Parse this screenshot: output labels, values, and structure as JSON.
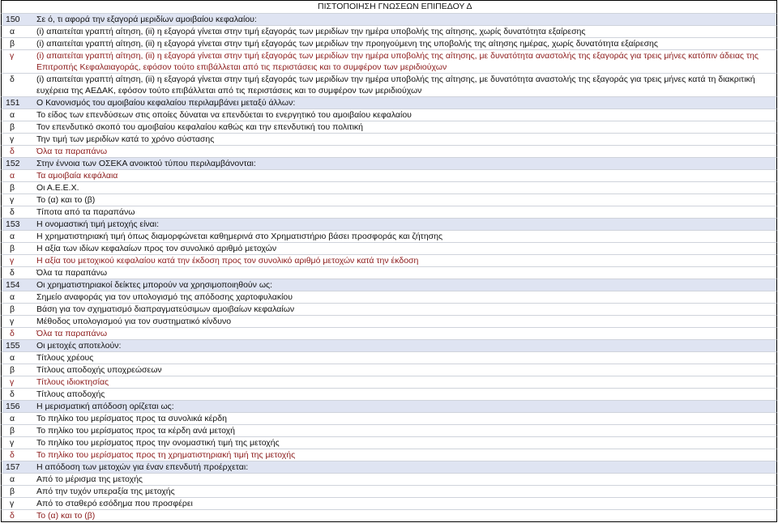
{
  "header": {
    "title": "ΠΙΣΤΟΠΟΙΗΣΗ ΓΝΩΣΕΩΝ ΕΠΙΠΕΔΟΥ Δ"
  },
  "questions": [
    {
      "number": "150",
      "text": "Σε ό, τι αφορά την εξαγορά μεριδίων αμοιβαίου κεφαλαίου:",
      "options": [
        {
          "letter": "α",
          "text": "(i) απαιτείται γραπτή αίτηση, (ii) η εξαγορά γίνεται στην τιμή εξαγοράς των μεριδίων την ημέρα υποβολής της αίτησης, χωρίς δυνατότητα εξαίρεσης",
          "correct": false
        },
        {
          "letter": "β",
          "text": "(i) απαιτείται γραπτή αίτηση, (ii) η εξαγορά γίνεται στην τιμή εξαγοράς των μεριδίων την προηγούμενη της υποβολής της αίτησης ημέρας, χωρίς δυνατότητα εξαίρεσης",
          "correct": false
        },
        {
          "letter": "γ",
          "text": "(i) απαιτείται γραπτή αίτηση, (ii) η εξαγορά γίνεται στην τιμή εξαγοράς των μεριδίων την ημέρα υποβολής της αίτησης, με δυνατότητα αναστολής της εξαγοράς για τρεις μήνες κατόπιν άδειας της Επιτροπής Κεφαλαιαγοράς, εφόσον τούτο επιβάλλεται από τις περιστάσεις και το συμφέρον των μεριδιούχων",
          "correct": true
        },
        {
          "letter": "δ",
          "text": "(i) απαιτείται γραπτή αίτηση, (ii) η εξαγορά γίνεται στην τιμή εξαγοράς των μεριδίων την ημέρα υποβολής της αίτησης, με δυνατότητα αναστολής της εξαγοράς για τρεις μήνες κατά τη διακριτική ευχέρεια της ΑΕΔΑΚ, εφόσον τούτο επιβάλλεται από τις περιστάσεις και το συμφέρον των μεριδιούχων",
          "correct": false
        }
      ]
    },
    {
      "number": "151",
      "text": "Ο Κανονισμός του αμοιβαίου κεφαλαίου περιλαμβάνει μεταξύ άλλων:",
      "options": [
        {
          "letter": "α",
          "text": "Το είδος των επενδύσεων στις οποίες δύναται να επενδύεται το ενεργητικό του αμοιβαίου κεφαλαίου",
          "correct": false
        },
        {
          "letter": "β",
          "text": "Τον επενδυτικό σκοπό του αμοιβαίου κεφαλαίου καθώς και την επενδυτική του πολιτική",
          "correct": false
        },
        {
          "letter": "γ",
          "text": "Την τιμή των μεριδίων κατά το χρόνο σύστασης",
          "correct": false
        },
        {
          "letter": "δ",
          "text": "Όλα τα παραπάνω",
          "correct": true
        }
      ]
    },
    {
      "number": "152",
      "text": "Στην έννοια των ΟΣΕΚΑ ανοικτού τύπου περιλαμβάνονται:",
      "options": [
        {
          "letter": "α",
          "text": "Τα αμοιβαία κεφάλαια",
          "correct": true
        },
        {
          "letter": "β",
          "text": "Οι Α.Ε.Ε.Χ.",
          "correct": false
        },
        {
          "letter": "γ",
          "text": "Το (α) και το (β)",
          "correct": false
        },
        {
          "letter": "δ",
          "text": "Τίποτα από τα παραπάνω",
          "correct": false
        }
      ]
    },
    {
      "number": "153",
      "text": "Η ονομαστική τιμή μετοχής είναι:",
      "options": [
        {
          "letter": "α",
          "text": "Η χρηματιστηριακή τιμή όπως διαμορφώνεται καθημερινά στο Χρηματιστήριο βάσει προσφοράς και ζήτησης",
          "correct": false
        },
        {
          "letter": "β",
          "text": "Η αξία των ιδίων κεφαλαίων προς τον συνολικό αριθμό μετοχών",
          "correct": false
        },
        {
          "letter": "γ",
          "text": "Η αξία του μετοχικού κεφαλαίου κατά την έκδοση προς τον συνολικό αριθμό μετοχών κατά την έκδοση",
          "correct": true
        },
        {
          "letter": "δ",
          "text": "Όλα τα παραπάνω",
          "correct": false
        }
      ]
    },
    {
      "number": "154",
      "text": "Οι χρηματιστηριακοί δείκτες μπορούν να χρησιμοποιηθούν ως:",
      "options": [
        {
          "letter": "α",
          "text": "Σημείο αναφοράς για τον υπολογισμό της απόδοσης χαρτοφυλακίου",
          "correct": false
        },
        {
          "letter": "β",
          "text": "Βάση για τον σχηματισμό διαπραγματεύσιμων αμοιβαίων κεφαλαίων",
          "correct": false
        },
        {
          "letter": "γ",
          "text": "Μέθοδος υπολογισμού για τον συστηματικό κίνδυνο",
          "correct": false
        },
        {
          "letter": "δ",
          "text": "Όλα τα παραπάνω",
          "correct": true
        }
      ]
    },
    {
      "number": "155",
      "text": "Οι μετοχές αποτελούν:",
      "options": [
        {
          "letter": "α",
          "text": "Τίτλους χρέους",
          "correct": false
        },
        {
          "letter": "β",
          "text": "Τίτλους αποδοχής υποχρεώσεων",
          "correct": false
        },
        {
          "letter": "γ",
          "text": "Τίτλους ιδιοκτησίας",
          "correct": true
        },
        {
          "letter": "δ",
          "text": "Τίτλους αποδοχής",
          "correct": false
        }
      ]
    },
    {
      "number": "156",
      "text": "Η μερισματική απόδοση ορίζεται ως:",
      "options": [
        {
          "letter": "α",
          "text": "Το πηλίκο του μερίσματος προς τα συνολικά κέρδη",
          "correct": false
        },
        {
          "letter": "β",
          "text": "Το πηλίκο του μερίσματος προς τα κέρδη ανά μετοχή",
          "correct": false
        },
        {
          "letter": "γ",
          "text": "Το πηλίκο του μερίσματος προς την ονομαστική τιμή της μετοχής",
          "correct": false
        },
        {
          "letter": "δ",
          "text": "Το πηλίκο του μερίσματος προς τη χρηματιστηριακή τιμή της μετοχής",
          "correct": true
        }
      ]
    },
    {
      "number": "157",
      "text": "Η απόδοση των μετοχών για έναν επενδυτή προέρχεται:",
      "options": [
        {
          "letter": "α",
          "text": "Από το μέρισμα της μετοχής",
          "correct": false
        },
        {
          "letter": "β",
          "text": "Από την τυχόν υπεραξία της μετοχής",
          "correct": false
        },
        {
          "letter": "γ",
          "text": "Από το σταθερό εσόδημα που προσφέρει",
          "correct": false
        },
        {
          "letter": "δ",
          "text": "Το (α) και το (β)",
          "correct": true
        }
      ]
    }
  ]
}
